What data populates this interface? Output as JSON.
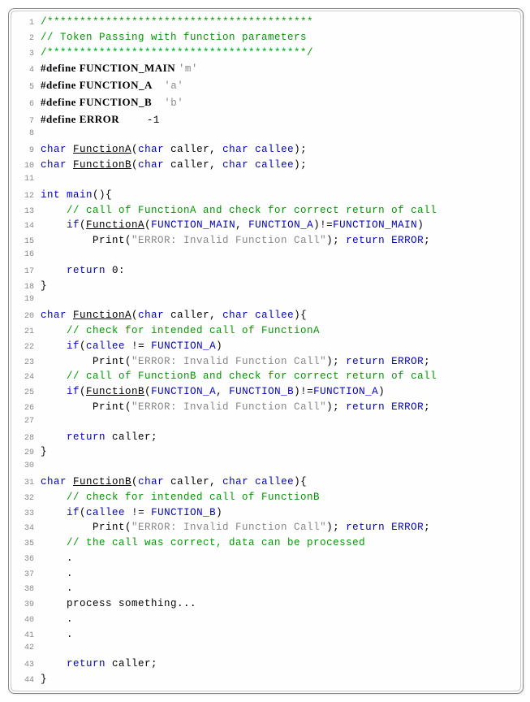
{
  "lines": [
    {
      "n": 1,
      "tokens": [
        {
          "t": "/*****************************************",
          "c": "comment"
        }
      ]
    },
    {
      "n": 2,
      "tokens": [
        {
          "t": "// Token Passing with function parameters",
          "c": "comment"
        }
      ]
    },
    {
      "n": 3,
      "tokens": [
        {
          "t": "/****************************************/",
          "c": "comment"
        }
      ]
    },
    {
      "n": 4,
      "tokens": [
        {
          "t": "#define FUNCTION_MAIN ",
          "c": "define"
        },
        {
          "t": "'m'",
          "c": "char"
        }
      ]
    },
    {
      "n": 5,
      "tokens": [
        {
          "t": "#define FUNCTION_A    ",
          "c": "define"
        },
        {
          "t": "'a'",
          "c": "char"
        }
      ]
    },
    {
      "n": 6,
      "tokens": [
        {
          "t": "#define FUNCTION_B    ",
          "c": "define"
        },
        {
          "t": "'b'",
          "c": "char"
        }
      ]
    },
    {
      "n": 7,
      "tokens": [
        {
          "t": "#define ERROR         ",
          "c": "define"
        },
        {
          "t": "-1",
          "c": ""
        }
      ]
    },
    {
      "n": 8,
      "tokens": []
    },
    {
      "n": 9,
      "tokens": [
        {
          "t": "char",
          "c": "kwblue"
        },
        {
          "t": " ",
          "c": ""
        },
        {
          "t": "FunctionA",
          "c": "funcname"
        },
        {
          "t": "(",
          "c": ""
        },
        {
          "t": "char",
          "c": "kwblue"
        },
        {
          "t": " caller, ",
          "c": ""
        },
        {
          "t": "char",
          "c": "kwblue"
        },
        {
          "t": " ",
          "c": ""
        },
        {
          "t": "callee",
          "c": "type"
        },
        {
          "t": ");",
          "c": ""
        }
      ]
    },
    {
      "n": 10,
      "tokens": [
        {
          "t": "char",
          "c": "kwblue"
        },
        {
          "t": " ",
          "c": ""
        },
        {
          "t": "FunctionB",
          "c": "funcname"
        },
        {
          "t": "(",
          "c": ""
        },
        {
          "t": "char",
          "c": "kwblue"
        },
        {
          "t": " caller, ",
          "c": ""
        },
        {
          "t": "char",
          "c": "kwblue"
        },
        {
          "t": " ",
          "c": ""
        },
        {
          "t": "callee",
          "c": "type"
        },
        {
          "t": ");",
          "c": ""
        }
      ]
    },
    {
      "n": 11,
      "tokens": []
    },
    {
      "n": 12,
      "tokens": [
        {
          "t": "int",
          "c": "kwblue"
        },
        {
          "t": " ",
          "c": ""
        },
        {
          "t": "main",
          "c": "type"
        },
        {
          "t": "(){",
          "c": ""
        }
      ]
    },
    {
      "n": 13,
      "tokens": [
        {
          "t": "    ",
          "c": ""
        },
        {
          "t": "// call of FunctionA and check for correct return of call",
          "c": "comment"
        }
      ]
    },
    {
      "n": 14,
      "tokens": [
        {
          "t": "    ",
          "c": ""
        },
        {
          "t": "if",
          "c": "kwblue"
        },
        {
          "t": "(",
          "c": ""
        },
        {
          "t": "FunctionA",
          "c": "funcname"
        },
        {
          "t": "(",
          "c": ""
        },
        {
          "t": "FUNCTION_MAIN",
          "c": "type"
        },
        {
          "t": ", ",
          "c": ""
        },
        {
          "t": "FUNCTION_A",
          "c": "type"
        },
        {
          "t": ")!=",
          "c": ""
        },
        {
          "t": "FUNCTION_MAIN",
          "c": "type"
        },
        {
          "t": ")",
          "c": ""
        }
      ]
    },
    {
      "n": 15,
      "tokens": [
        {
          "t": "        Print(",
          "c": ""
        },
        {
          "t": "\"ERROR: Invalid Function Call\"",
          "c": "string"
        },
        {
          "t": "); ",
          "c": ""
        },
        {
          "t": "return",
          "c": "kwblue"
        },
        {
          "t": " ",
          "c": ""
        },
        {
          "t": "ERROR",
          "c": "type"
        },
        {
          "t": ";",
          "c": ""
        }
      ]
    },
    {
      "n": 16,
      "tokens": []
    },
    {
      "n": 17,
      "tokens": [
        {
          "t": "    ",
          "c": ""
        },
        {
          "t": "return",
          "c": "kwblue"
        },
        {
          "t": " 0:",
          "c": ""
        }
      ]
    },
    {
      "n": 18,
      "tokens": [
        {
          "t": "}",
          "c": ""
        }
      ]
    },
    {
      "n": 19,
      "tokens": []
    },
    {
      "n": 20,
      "tokens": [
        {
          "t": "char",
          "c": "kwblue"
        },
        {
          "t": " ",
          "c": ""
        },
        {
          "t": "FunctionA",
          "c": "funcname"
        },
        {
          "t": "(",
          "c": ""
        },
        {
          "t": "char",
          "c": "kwblue"
        },
        {
          "t": " caller, ",
          "c": ""
        },
        {
          "t": "char",
          "c": "kwblue"
        },
        {
          "t": " ",
          "c": ""
        },
        {
          "t": "callee",
          "c": "type"
        },
        {
          "t": "){",
          "c": ""
        }
      ]
    },
    {
      "n": 21,
      "tokens": [
        {
          "t": "    ",
          "c": ""
        },
        {
          "t": "// check for intended call of FunctionA",
          "c": "comment"
        }
      ]
    },
    {
      "n": 22,
      "tokens": [
        {
          "t": "    ",
          "c": ""
        },
        {
          "t": "if",
          "c": "kwblue"
        },
        {
          "t": "(",
          "c": ""
        },
        {
          "t": "callee",
          "c": "type"
        },
        {
          "t": " != ",
          "c": ""
        },
        {
          "t": "FUNCTION_A",
          "c": "type"
        },
        {
          "t": ")",
          "c": ""
        }
      ]
    },
    {
      "n": 23,
      "tokens": [
        {
          "t": "        Print(",
          "c": ""
        },
        {
          "t": "\"ERROR: Invalid Function Call\"",
          "c": "string"
        },
        {
          "t": "); ",
          "c": ""
        },
        {
          "t": "return",
          "c": "kwblue"
        },
        {
          "t": " ",
          "c": ""
        },
        {
          "t": "ERROR",
          "c": "type"
        },
        {
          "t": ";",
          "c": ""
        }
      ]
    },
    {
      "n": 24,
      "tokens": [
        {
          "t": "    ",
          "c": ""
        },
        {
          "t": "// call of FunctionB and check for correct return of call",
          "c": "comment"
        }
      ]
    },
    {
      "n": 25,
      "tokens": [
        {
          "t": "    ",
          "c": ""
        },
        {
          "t": "if",
          "c": "kwblue"
        },
        {
          "t": "(",
          "c": ""
        },
        {
          "t": "FunctionB",
          "c": "funcname"
        },
        {
          "t": "(",
          "c": ""
        },
        {
          "t": "FUNCTION_A",
          "c": "type"
        },
        {
          "t": ", ",
          "c": ""
        },
        {
          "t": "FUNCTION_B",
          "c": "type"
        },
        {
          "t": ")!=",
          "c": ""
        },
        {
          "t": "FUNCTION_A",
          "c": "type"
        },
        {
          "t": ")",
          "c": ""
        }
      ]
    },
    {
      "n": 26,
      "tokens": [
        {
          "t": "        Print(",
          "c": ""
        },
        {
          "t": "\"ERROR: Invalid Function Call\"",
          "c": "string"
        },
        {
          "t": "); ",
          "c": ""
        },
        {
          "t": "return",
          "c": "kwblue"
        },
        {
          "t": " ",
          "c": ""
        },
        {
          "t": "ERROR",
          "c": "type"
        },
        {
          "t": ";",
          "c": ""
        }
      ]
    },
    {
      "n": 27,
      "tokens": []
    },
    {
      "n": 28,
      "tokens": [
        {
          "t": "    ",
          "c": ""
        },
        {
          "t": "return",
          "c": "kwblue"
        },
        {
          "t": " caller;",
          "c": ""
        }
      ]
    },
    {
      "n": 29,
      "tokens": [
        {
          "t": "}",
          "c": ""
        }
      ]
    },
    {
      "n": 30,
      "tokens": []
    },
    {
      "n": 31,
      "tokens": [
        {
          "t": "char",
          "c": "kwblue"
        },
        {
          "t": " ",
          "c": ""
        },
        {
          "t": "FunctionB",
          "c": "funcname"
        },
        {
          "t": "(",
          "c": ""
        },
        {
          "t": "char",
          "c": "kwblue"
        },
        {
          "t": " caller, ",
          "c": ""
        },
        {
          "t": "char",
          "c": "kwblue"
        },
        {
          "t": " ",
          "c": ""
        },
        {
          "t": "callee",
          "c": "type"
        },
        {
          "t": "){",
          "c": ""
        }
      ]
    },
    {
      "n": 32,
      "tokens": [
        {
          "t": "    ",
          "c": ""
        },
        {
          "t": "// check for intended call of FunctionB",
          "c": "comment"
        }
      ]
    },
    {
      "n": 33,
      "tokens": [
        {
          "t": "    ",
          "c": ""
        },
        {
          "t": "if",
          "c": "kwblue"
        },
        {
          "t": "(",
          "c": ""
        },
        {
          "t": "callee",
          "c": "type"
        },
        {
          "t": " != ",
          "c": ""
        },
        {
          "t": "FUNCTION_B",
          "c": "type"
        },
        {
          "t": ")",
          "c": ""
        }
      ]
    },
    {
      "n": 34,
      "tokens": [
        {
          "t": "        Print(",
          "c": ""
        },
        {
          "t": "\"ERROR: Invalid Function Call\"",
          "c": "string"
        },
        {
          "t": "); ",
          "c": ""
        },
        {
          "t": "return",
          "c": "kwblue"
        },
        {
          "t": " ",
          "c": ""
        },
        {
          "t": "ERROR",
          "c": "type"
        },
        {
          "t": ";",
          "c": ""
        }
      ]
    },
    {
      "n": 35,
      "tokens": [
        {
          "t": "    ",
          "c": ""
        },
        {
          "t": "// the call was correct, data can be processed",
          "c": "comment"
        }
      ]
    },
    {
      "n": 36,
      "tokens": [
        {
          "t": "    .",
          "c": ""
        }
      ]
    },
    {
      "n": 37,
      "tokens": [
        {
          "t": "    .",
          "c": ""
        }
      ]
    },
    {
      "n": 38,
      "tokens": [
        {
          "t": "    .",
          "c": ""
        }
      ]
    },
    {
      "n": 39,
      "tokens": [
        {
          "t": "    process something...",
          "c": ""
        }
      ]
    },
    {
      "n": 40,
      "tokens": [
        {
          "t": "    .",
          "c": ""
        }
      ]
    },
    {
      "n": 41,
      "tokens": [
        {
          "t": "    .",
          "c": ""
        }
      ]
    },
    {
      "n": 42,
      "tokens": []
    },
    {
      "n": 43,
      "tokens": [
        {
          "t": "    ",
          "c": ""
        },
        {
          "t": "return",
          "c": "kwblue"
        },
        {
          "t": " caller;",
          "c": ""
        }
      ]
    },
    {
      "n": 44,
      "tokens": [
        {
          "t": "}",
          "c": ""
        }
      ]
    }
  ]
}
